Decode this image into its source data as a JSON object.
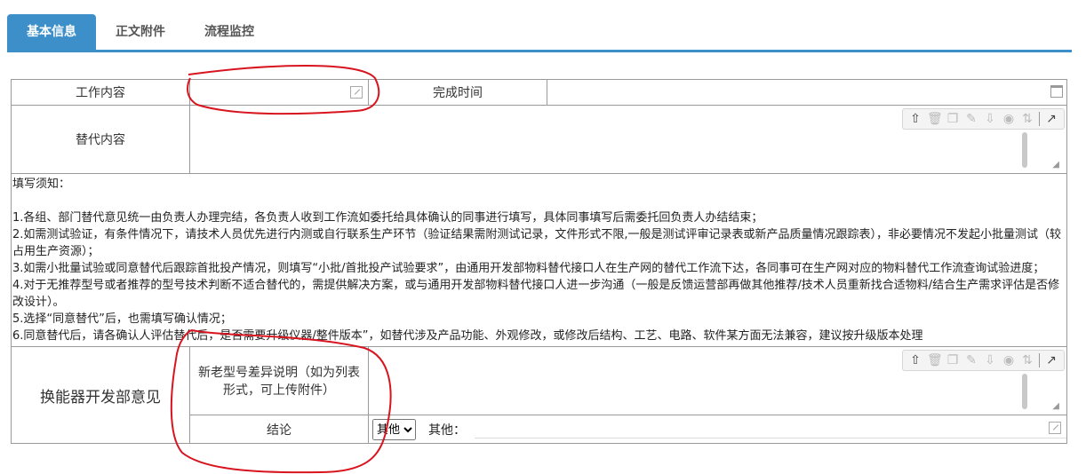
{
  "tabs": [
    {
      "label": "基本信息",
      "active": true
    },
    {
      "label": "正文附件",
      "active": false
    },
    {
      "label": "流程监控",
      "active": false
    }
  ],
  "form": {
    "work_content_label": "工作内容",
    "work_content_value": "",
    "finish_time_label": "完成时间",
    "finish_time_value": "",
    "replace_content_label": "替代内容",
    "replace_content_value": "",
    "notes": [
      "填写须知：",
      "",
      "1.各组、部门替代意见统一由负责人办理完结，各负责人收到工作流如委托给具体确认的同事进行填写，具体同事填写后需委托回负责人办结结束；",
      "2.如需测试验证，有条件情况下，请技术人员优先进行内测或自行联系生产环节（验证结果需附测试记录，文件形式不限,一般是测试评审记录表或新产品质量情况跟踪表），非必要情况不发起小批量测试（较占用生产资源）；",
      "3.如需小批量试验或同意替代后跟踪首批投产情况，则填写“小批/首批投产试验要求”，由通用开发部物料替代接口人在生产网的替代工作流下达，各同事可在生产网对应的物料替代工作流查询试验进度；",
      "4.对于无推荐型号或者推荐的型号技术判断不适合替代的，需提供解决方案，或与通用开发部物料替代接口人进一步沟通（一般是反馈运营部再做其他推荐/技术人员重新找合适物料/结合生产需求评估是否修改设计）。",
      "5.选择“同意替代”后，也需填写确认情况；",
      "6.同意替代后，请各确认人评估替代后，是否需要升级仪器/整件版本”，如替代涉及产品功能、外观修改，或修改后结构、工艺、电路、软件某方面无法兼容，建议按升级版本处理"
    ],
    "dept_label": "换能器开发部意见",
    "diff_label": "新老型号差异说明（如为列表形式，可上传附件）",
    "diff_value": "",
    "conclusion_label": "结论",
    "conclusion_selected": "其他",
    "conclusion_options": [
      "其他"
    ],
    "other_label": "其他：",
    "other_value": ""
  },
  "toolbar_icons": [
    "upload-icon",
    "delete-icon",
    "copy-icon",
    "edit-icon",
    "download-icon",
    "preview-icon",
    "sort-icon",
    "open-external-icon"
  ],
  "colors": {
    "accent": "#3d8fc9",
    "annotation": "#d8141e",
    "border": "#9a9a9a"
  }
}
